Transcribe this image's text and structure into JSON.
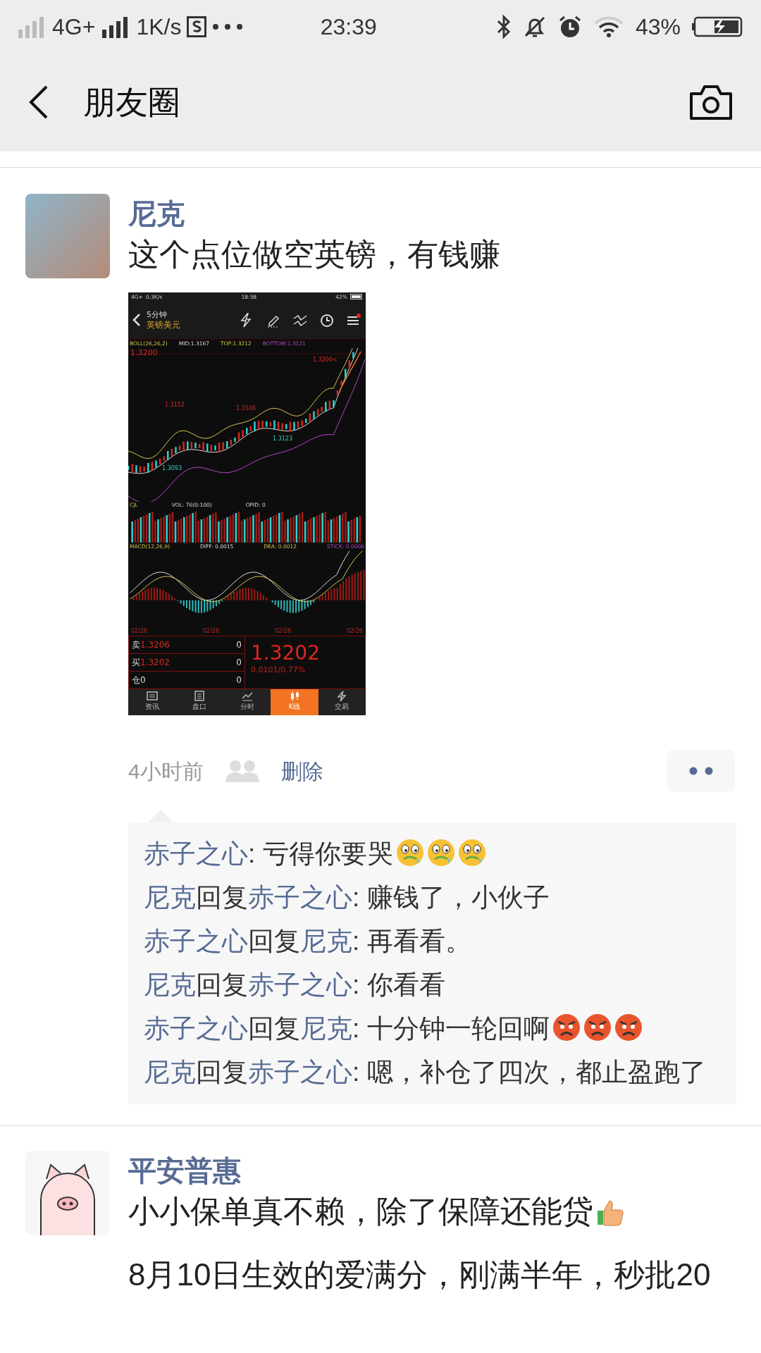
{
  "status_bar": {
    "network": "4G+",
    "speed": "1K/s",
    "time": "23:39",
    "battery": "43%"
  },
  "header": {
    "title": "朋友圈"
  },
  "posts": [
    {
      "kind": "image",
      "author": "尼克",
      "text": "这个点位做空英镑，有钱赚",
      "screenshot": {
        "status": {
          "network": "4G+",
          "speed": "0.3K/s",
          "time": "18:38",
          "battery": "42%"
        },
        "period": "5分钟",
        "symbol": "英镑美元",
        "boll": [
          "BOLL(26,26,2)",
          "MID:1.3167",
          "TOP:1.3212",
          "BOTTOM:1.3121"
        ],
        "price_labels": [
          {
            "text": "1.3200",
            "kind": "axis"
          },
          {
            "text": "1.3206<",
            "kind": "high"
          },
          {
            "text": "1.3152",
            "kind": "high"
          },
          {
            "text": "1.3146",
            "kind": "high"
          },
          {
            "text": "1.3123",
            "kind": "low"
          },
          {
            "text": "1.3093",
            "kind": "low"
          }
        ],
        "volume_header": [
          "CJL",
          "VOL: 76(0:100)",
          "OPID: 0"
        ],
        "macd_header": [
          "MACD(12,26,9)",
          "DIFF: 0.0015",
          "DEA: 0.0012",
          "STICK: 0.0006"
        ],
        "dates": [
          "02/26",
          "02/26",
          "02/26",
          "02/26"
        ],
        "quotes": [
          {
            "label": "卖",
            "price": "1.3206",
            "qty": "0"
          },
          {
            "label": "买",
            "price": "1.3202",
            "qty": "0"
          },
          {
            "label": "仓",
            "price": "0",
            "qty": "0"
          }
        ],
        "last_price": "1.3202",
        "change": "0.0101/0.77%",
        "tabs": [
          {
            "label": "资讯",
            "selected": false
          },
          {
            "label": "盘口",
            "selected": false
          },
          {
            "label": "分时",
            "selected": false
          },
          {
            "label": "K线",
            "selected": true
          },
          {
            "label": "交易",
            "selected": false
          }
        ]
      },
      "time": "4小时前",
      "delete": "删除",
      "comments": [
        {
          "kind": "sweat",
          "from": "赤子之心",
          "text": ": 亏得你要哭"
        },
        {
          "kind": "plain",
          "from": "尼克",
          "verb": "回复",
          "to": "赤子之心",
          "text": ": 赚钱了，小伙子"
        },
        {
          "kind": "plain",
          "from": "赤子之心",
          "verb": "回复",
          "to": "尼克",
          "text": ": 再看看。"
        },
        {
          "kind": "plain",
          "from": "尼克",
          "verb": "回复",
          "to": "赤子之心",
          "text": ": 你看看"
        },
        {
          "kind": "angry",
          "from": "赤子之心",
          "verb": "回复",
          "to": "尼克",
          "text": ": 十分钟一轮回啊"
        },
        {
          "kind": "plain",
          "from": "尼克",
          "verb": "回复",
          "to": "赤子之心",
          "text": ": 嗯，补仓了四次，都止盈跑了"
        }
      ]
    },
    {
      "kind": "thumbs-up",
      "author": "平安普惠",
      "text": "小小保单真不赖，除了保障还能贷",
      "text_2": "8月10日生效的爱满分，刚满半年，秒批20"
    }
  ]
}
